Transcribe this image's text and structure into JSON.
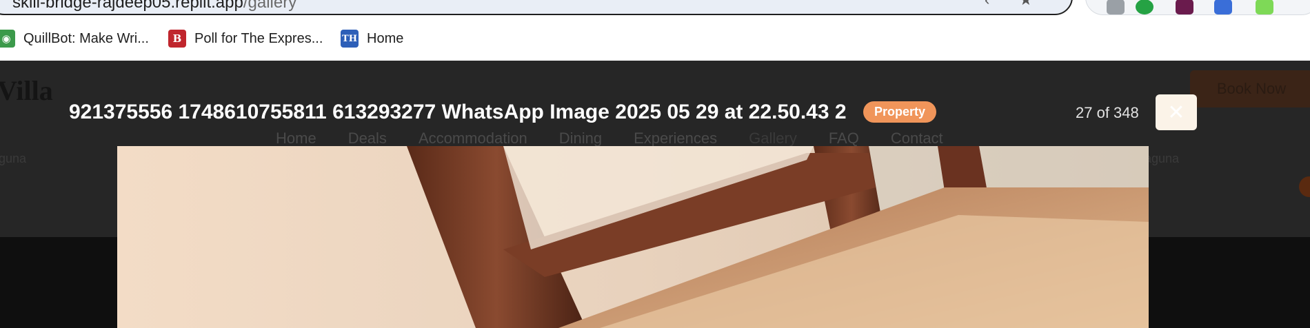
{
  "browser": {
    "url_host": "skill-bridge-rajdeep05.replit.app",
    "url_path": "/gallery",
    "bookmarks": [
      {
        "label": "QuillBot: Make Wri...",
        "icon": "quillbot-icon",
        "color": "#3c9a4b"
      },
      {
        "label": "Poll for The Expres...",
        "icon": "express-b-icon",
        "color": "#c0262d"
      },
      {
        "label": "Home",
        "icon": "th-icon",
        "color": "#2d5fb8"
      }
    ],
    "extensions": [
      {
        "icon": "extension-grey-icon",
        "color": "#9aa0a6"
      },
      {
        "icon": "whatsapp-icon",
        "color": "#25a244"
      },
      {
        "icon": "slack-icon",
        "color": "#6a1b4d"
      },
      {
        "icon": "translate-icon",
        "color": "#3a6ed8"
      },
      {
        "icon": "extension-green-icon",
        "color": "#7ed957"
      }
    ]
  },
  "site": {
    "logo": "Villa",
    "nav": [
      "Home",
      "Deals",
      "Accommodation",
      "Dining",
      "Experiences",
      "Gallery",
      "FAQ",
      "Contact"
    ],
    "book_now": "Book Now",
    "sub_left": "iguna",
    "sub_right": "aguna"
  },
  "lightbox": {
    "title": "921375556 1748610755811 613293277 WhatsApp Image 2025 05 29 at 22.50.43 2",
    "badge": "Property",
    "counter": "27 of 348",
    "close_symbol": "✕",
    "accent": "#f0955a"
  }
}
